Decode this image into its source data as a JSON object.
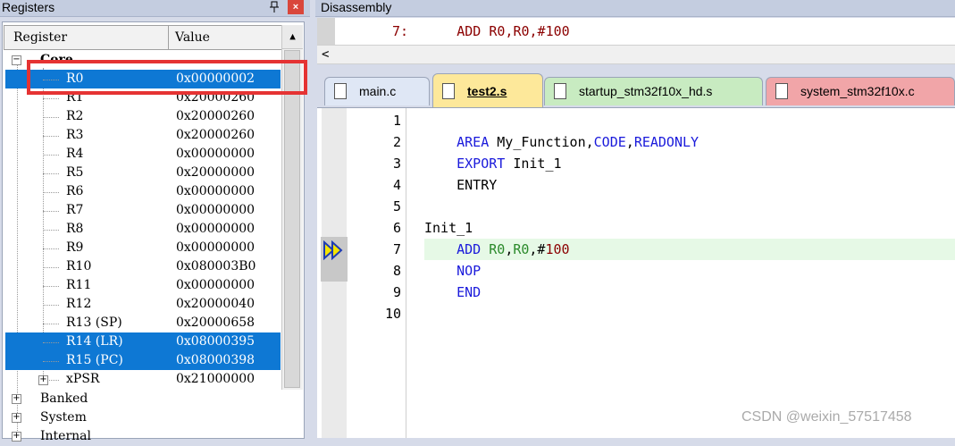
{
  "registers": {
    "title": "Registers",
    "pin_glyph": "₽",
    "close_glyph": "×",
    "col_register": "Register",
    "col_value": "Value",
    "group_core": "Core",
    "rows": [
      {
        "name": "R0",
        "value": "0x00000002",
        "selected": true
      },
      {
        "name": "R1",
        "value": "0x20000260",
        "selected": false
      },
      {
        "name": "R2",
        "value": "0x20000260",
        "selected": false
      },
      {
        "name": "R3",
        "value": "0x20000260",
        "selected": false
      },
      {
        "name": "R4",
        "value": "0x00000000",
        "selected": false
      },
      {
        "name": "R5",
        "value": "0x20000000",
        "selected": false
      },
      {
        "name": "R6",
        "value": "0x00000000",
        "selected": false
      },
      {
        "name": "R7",
        "value": "0x00000000",
        "selected": false
      },
      {
        "name": "R8",
        "value": "0x00000000",
        "selected": false
      },
      {
        "name": "R9",
        "value": "0x00000000",
        "selected": false
      },
      {
        "name": "R10",
        "value": "0x080003B0",
        "selected": false
      },
      {
        "name": "R11",
        "value": "0x00000000",
        "selected": false
      },
      {
        "name": "R12",
        "value": "0x20000040",
        "selected": false
      },
      {
        "name": "R13 (SP)",
        "value": "0x20000658",
        "selected": false
      },
      {
        "name": "R14 (LR)",
        "value": "0x08000395",
        "selected": true
      },
      {
        "name": "R15 (PC)",
        "value": "0x08000398",
        "selected": true
      },
      {
        "name": "xPSR",
        "value": "0x21000000",
        "selected": false
      }
    ],
    "groups": [
      "Banked",
      "System",
      "Internal"
    ]
  },
  "disassembly": {
    "title": "Disassembly",
    "line_no": "7:",
    "instruction": "ADD R0,R0,#100",
    "scroll_left": "<"
  },
  "tabs": [
    {
      "label": "main.c",
      "active": false
    },
    {
      "label": "test2.s",
      "active": true
    },
    {
      "label": "startup_stm32f10x_hd.s",
      "active": false
    },
    {
      "label": "system_stm32f10x.c",
      "active": false
    }
  ],
  "editor": {
    "line_numbers": [
      "1",
      "2",
      "3",
      "4",
      "5",
      "6",
      "7",
      "8",
      "9",
      "10"
    ],
    "line2": {
      "kw1": "AREA",
      "name": " My_Function,",
      "kw2": "CODE",
      "c": ",",
      "kw3": "READONLY"
    },
    "line3": {
      "kw": "EXPORT",
      "rest": " Init_1"
    },
    "line4": "ENTRY",
    "line6": "Init_1",
    "line7": {
      "kw": "ADD",
      "r1": "R0",
      "c1": ",",
      "r2": "R0",
      "c2": ",#",
      "num": "100"
    },
    "line8": "NOP",
    "line9": "END"
  },
  "watermark": "CSDN @weixin_57517458"
}
